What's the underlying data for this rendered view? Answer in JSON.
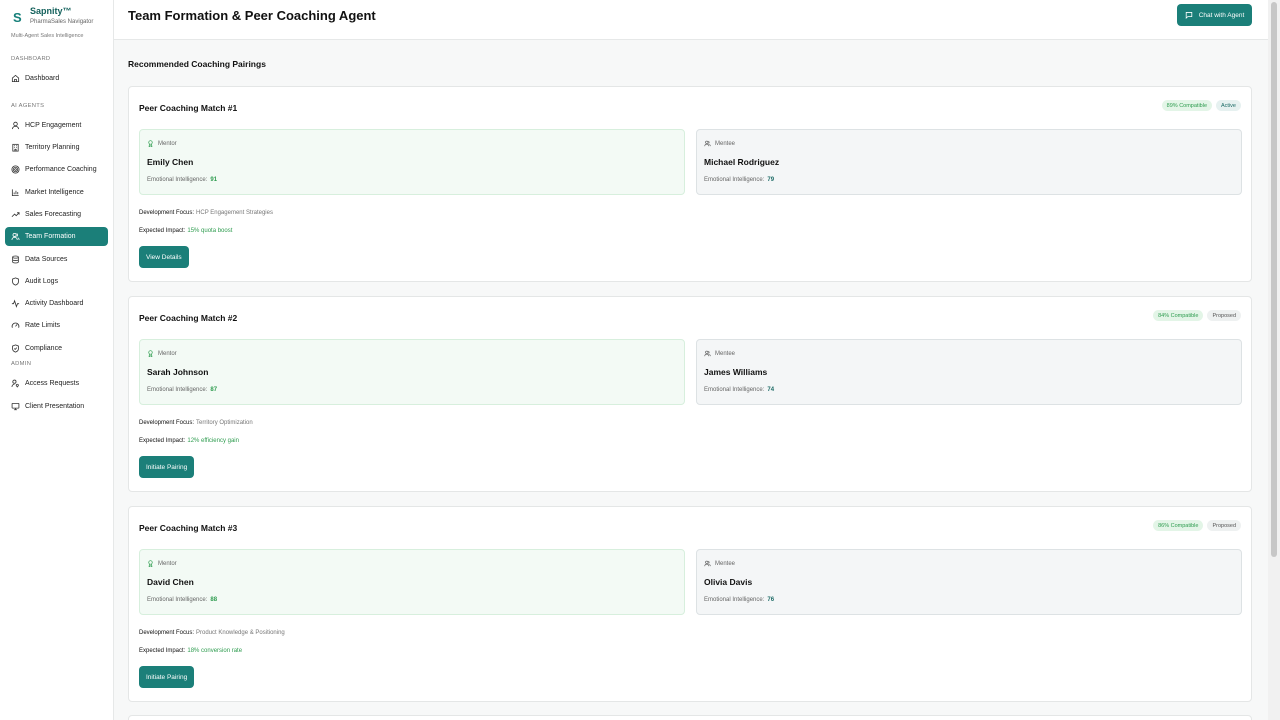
{
  "brand": {
    "initial": "S",
    "name": "Sapnity™",
    "sub": "PharmaSales Navigator",
    "tagline": "Multi-Agent Sales Intelligence"
  },
  "sidebar": {
    "section_dashboard": "DASHBOARD",
    "section_agents": "AI AGENTS",
    "section_admin": "ADMIN",
    "items": [
      {
        "label": "Dashboard",
        "icon": "home-icon"
      },
      {
        "label": "HCP Engagement",
        "icon": "user-icon"
      },
      {
        "label": "Territory Planning",
        "icon": "building-icon"
      },
      {
        "label": "Performance Coaching",
        "icon": "target-icon"
      },
      {
        "label": "Market Intelligence",
        "icon": "bar-chart-icon"
      },
      {
        "label": "Sales Forecasting",
        "icon": "trending-up-icon"
      },
      {
        "label": "Team Formation",
        "icon": "users-icon"
      },
      {
        "label": "Data Sources",
        "icon": "database-icon"
      },
      {
        "label": "Audit Logs",
        "icon": "shield-icon"
      },
      {
        "label": "Activity Dashboard",
        "icon": "activity-icon"
      },
      {
        "label": "Rate Limits",
        "icon": "gauge-icon"
      },
      {
        "label": "Compliance",
        "icon": "shield-check-icon"
      },
      {
        "label": "Access Requests",
        "icon": "user-key-icon"
      },
      {
        "label": "Client Presentation",
        "icon": "monitor-icon"
      }
    ]
  },
  "header": {
    "title": "Team Formation & Peer Coaching Agent",
    "chat_label": "Chat with Agent"
  },
  "main": {
    "section_title": "Recommended Coaching Pairings",
    "labels": {
      "mentor": "Mentor",
      "mentee": "Mentee",
      "ei": "Emotional Intelligence:",
      "focus": "Development Focus:",
      "impact": "Expected Impact:"
    },
    "matches": [
      {
        "title": "Peer Coaching Match #1",
        "compat": "89% Compatible",
        "status": "Active",
        "mentor_name": "Emily Chen",
        "mentor_ei": "91",
        "mentee_name": "Michael Rodriguez",
        "mentee_ei": "79",
        "focus": "HCP Engagement Strategies",
        "impact": "15% quota boost",
        "button": "View Details"
      },
      {
        "title": "Peer Coaching Match #2",
        "compat": "84% Compatible",
        "status": "Proposed",
        "mentor_name": "Sarah Johnson",
        "mentor_ei": "87",
        "mentee_name": "James Williams",
        "mentee_ei": "74",
        "focus": "Territory Optimization",
        "impact": "12% efficiency gain",
        "button": "Initiate Pairing"
      },
      {
        "title": "Peer Coaching Match #3",
        "compat": "86% Compatible",
        "status": "Proposed",
        "mentor_name": "David Chen",
        "mentor_ei": "88",
        "mentee_name": "Olivia Davis",
        "mentee_ei": "76",
        "focus": "Product Knowledge & Positioning",
        "impact": "18% conversion rate",
        "button": "Initiate Pairing"
      }
    ]
  },
  "colors": {
    "accent": "#1b7f79",
    "success": "#2e9c4f"
  }
}
